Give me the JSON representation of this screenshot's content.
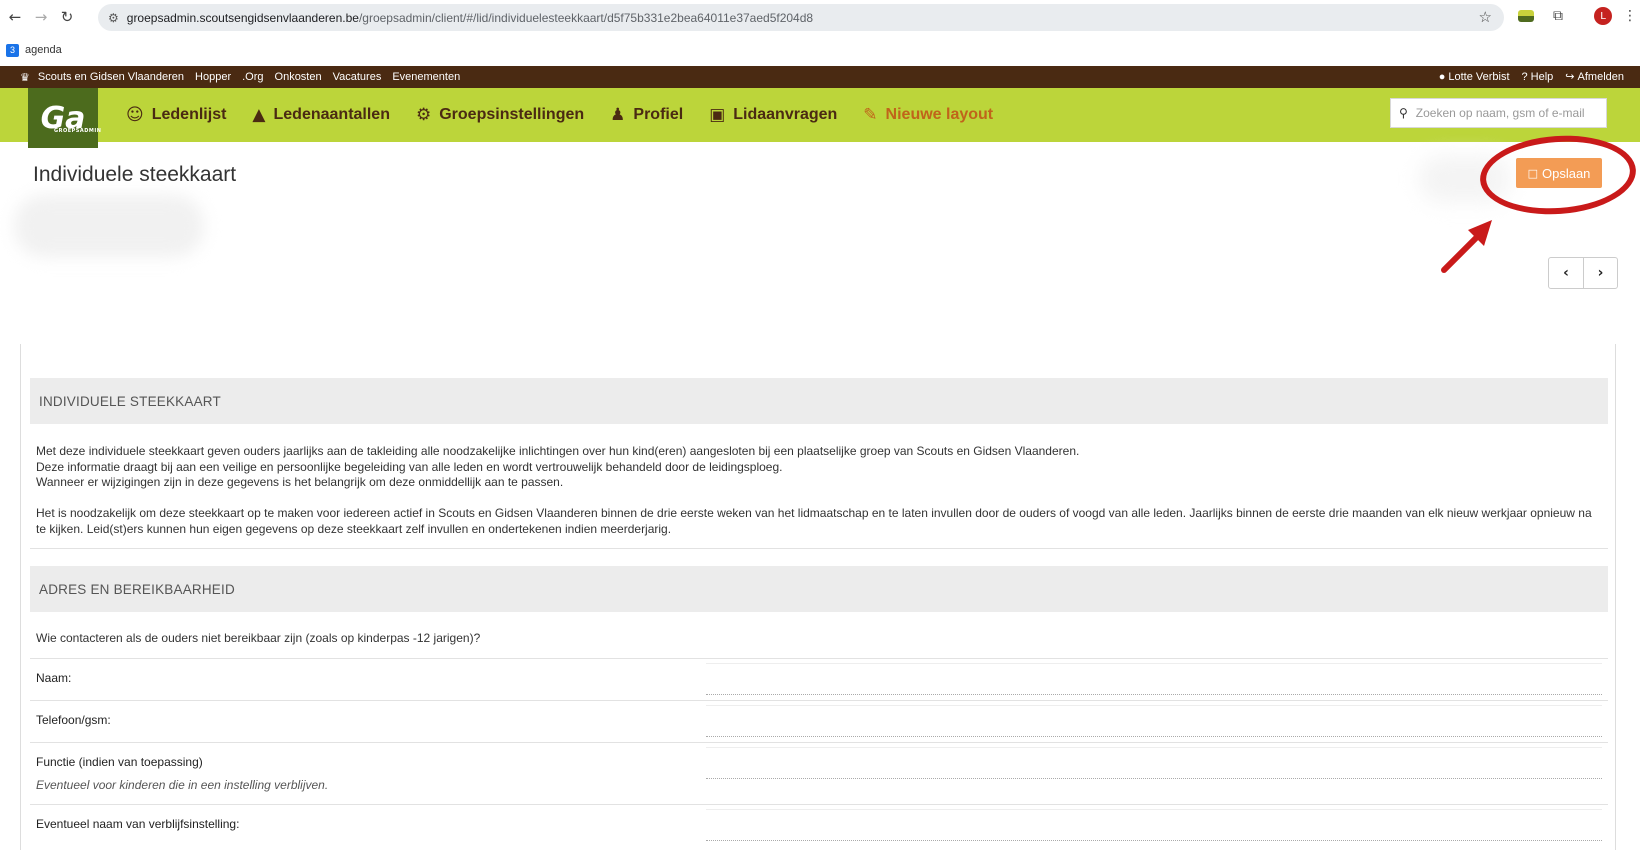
{
  "browser": {
    "url_host": "groepsadmin.scoutsengidsenvlaanderen.be",
    "url_path": "/groepsadmin/client/#/lid/individuelesteekkaart/d5f75b331e2bea64011e37aed5f204d8",
    "bookmark_icon": "3",
    "bookmark_label": "agenda",
    "profile_initial": "L"
  },
  "topbar": {
    "links": [
      "Scouts en Gidsen Vlaanderen",
      "Hopper",
      ".Org",
      "Onkosten",
      "Vacatures",
      "Evenementen"
    ],
    "user": "Lotte Verbist",
    "help": "Help",
    "logout": "Afmelden"
  },
  "nav": {
    "brand": "Ga",
    "brand_sub": "GROEPSADMIN",
    "items": [
      {
        "label": "Ledenlijst",
        "icon": "users-icon"
      },
      {
        "label": "Ledenaantallen",
        "icon": "area-chart-icon"
      },
      {
        "label": "Groepsinstellingen",
        "icon": "cogs-icon"
      },
      {
        "label": "Profiel",
        "icon": "user-icon"
      },
      {
        "label": "Lidaanvragen",
        "icon": "contact-card-icon"
      },
      {
        "label": "Nieuwe layout",
        "icon": "external-edit-icon"
      }
    ],
    "search_placeholder": "Zoeken op naam, gsm of e-mail"
  },
  "page": {
    "title": "Individuele steekkaart",
    "save_label": "Opslaan"
  },
  "sections": {
    "intro_heading": "INDIVIDUELE STEEKKAART",
    "intro_p1_l1": "Met deze individuele steekkaart geven ouders jaarlijks aan de takleiding alle noodzakelijke inlichtingen over hun kind(eren) aangesloten bij een plaatselijke groep van Scouts en Gidsen Vlaanderen.",
    "intro_p1_l2": "Deze informatie draagt bij aan een veilige en persoonlijke begeleiding van alle leden en wordt vertrouwelijk behandeld door de leidingsploeg.",
    "intro_p1_l3": "Wanneer er wijzigingen zijn in deze gegevens is het belangrijk om deze onmiddellijk aan te passen.",
    "intro_p2": "Het is noodzakelijk om deze steekkaart op te maken voor iedereen actief in Scouts en Gidsen Vlaanderen binnen de drie eerste weken van het lidmaatschap en te laten invullen door de ouders of voogd van alle leden. Jaarlijks binnen de eerste drie maanden van elk nieuw werkjaar opnieuw na te kijken. Leid(st)ers kunnen hun eigen gegevens op deze steekkaart zelf invullen en ondertekenen indien meerderjarig.",
    "address_heading": "ADRES EN BEREIKBAARHEID",
    "question": "Wie contacteren als de ouders niet bereikbaar zijn (zoals op kinderpas -12 jarigen)?",
    "fields": [
      {
        "label": "Naam:",
        "hint": ""
      },
      {
        "label": "Telefoon/gsm:",
        "hint": ""
      },
      {
        "label": "Functie (indien van toepassing)",
        "hint": "Eventueel voor kinderen die in een instelling verblijven."
      },
      {
        "label": "Eventueel naam van verblijfsinstelling:",
        "hint": ""
      }
    ]
  }
}
